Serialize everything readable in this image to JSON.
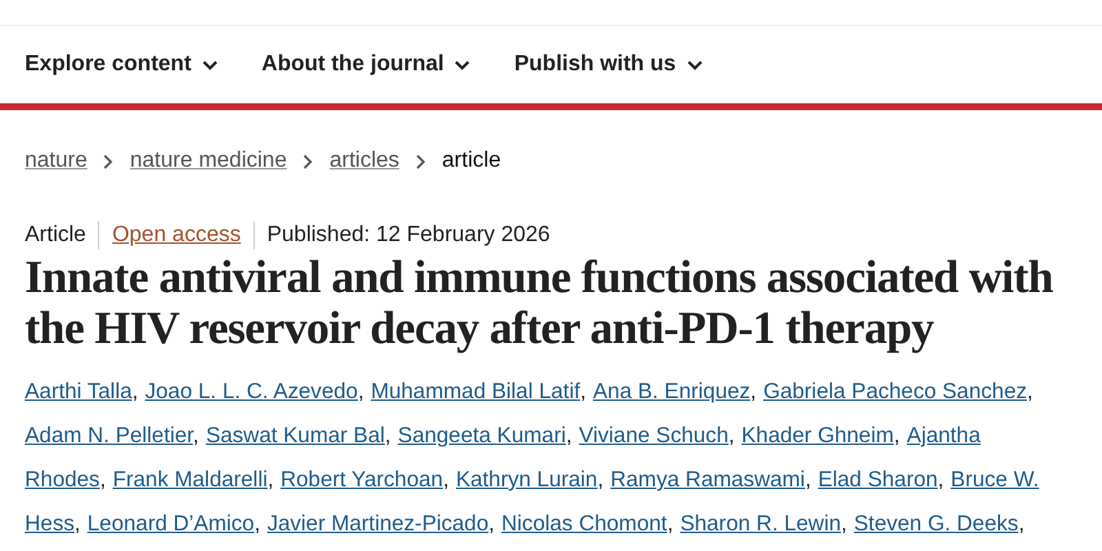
{
  "nav": [
    {
      "label": "Explore content"
    },
    {
      "label": "About the journal"
    },
    {
      "label": "Publish with us"
    }
  ],
  "breadcrumb": [
    {
      "label": "nature",
      "kind": "link"
    },
    {
      "label": "nature medicine",
      "kind": "link"
    },
    {
      "label": "articles",
      "kind": "link"
    },
    {
      "label": "article",
      "kind": "current"
    }
  ],
  "meta": [
    {
      "text": "Article",
      "kind": "plain"
    },
    {
      "text": "Open access",
      "kind": "link"
    },
    {
      "text": "Published: 12 February 2026",
      "kind": "plain"
    }
  ],
  "title": "Innate antiviral and immune functions associated with the HIV reservoir decay after anti-PD-1 therapy",
  "author_lines": [
    [
      {
        "name": "Aarthi Talla",
        "separator": ","
      },
      {
        "name": "Joao L. L. C. Azevedo",
        "separator": ","
      },
      {
        "name": "Muhammad Bilal Latif",
        "separator": ","
      },
      {
        "name": "Ana B. Enriquez",
        "separator": ","
      },
      {
        "name": "Gabriela Pacheco Sanchez",
        "separator": ","
      }
    ],
    [
      {
        "name": "Adam N. Pelletier",
        "separator": ","
      },
      {
        "name": "Saswat Kumar Bal",
        "separator": ","
      },
      {
        "name": "Sangeeta Kumari",
        "separator": ","
      },
      {
        "name": "Viviane Schuch",
        "separator": ","
      },
      {
        "name": "Khader Ghneim",
        "separator": ","
      },
      {
        "name": "Ajantha"
      }
    ],
    [
      {
        "name": "Rhodes",
        "separator": ","
      },
      {
        "name": "Frank Maldarelli",
        "separator": ","
      },
      {
        "name": "Robert Yarchoan",
        "separator": ","
      },
      {
        "name": "Kathryn Lurain",
        "separator": ","
      },
      {
        "name": "Ramya Ramaswami",
        "separator": ","
      },
      {
        "name": "Elad Sharon",
        "separator": ","
      },
      {
        "name": "Bruce W."
      }
    ],
    [
      {
        "name": "Hess",
        "separator": ","
      },
      {
        "name": "Leonard D’Amico",
        "separator": ","
      },
      {
        "name": "Javier Martinez-Picado",
        "separator": ","
      },
      {
        "name": "Nicolas Chomont",
        "separator": ","
      },
      {
        "name": "Sharon R. Lewin",
        "separator": ","
      },
      {
        "name": "Steven G. Deeks",
        "separator": ","
      }
    ]
  ]
}
